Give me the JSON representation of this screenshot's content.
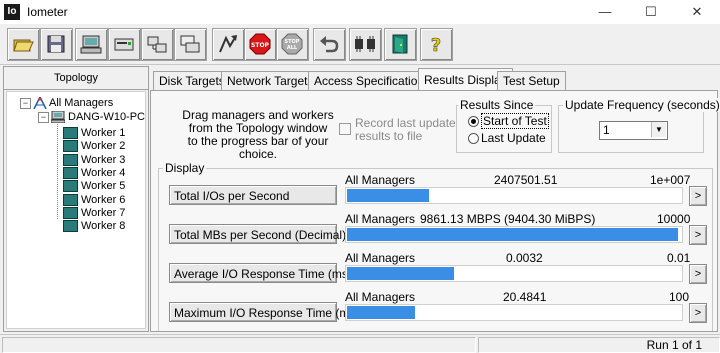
{
  "window": {
    "icon_text": "Io",
    "title": "Iometer"
  },
  "toolbar": {
    "icons": [
      "open-icon",
      "save-icon",
      "new-manager-icon",
      "new-disk-worker-icon",
      "new-network-worker-icon",
      "duplicate-worker-icon",
      "start-icon",
      "stop-icon",
      "stop-all-icon",
      "reset-workers-icon",
      "disconnect-icon",
      "exit-icon",
      "help-icon"
    ]
  },
  "topology": {
    "header": "Topology",
    "root": "All Managers",
    "manager": "DANG-W10-PC",
    "workers": [
      "Worker 1",
      "Worker 2",
      "Worker 3",
      "Worker 4",
      "Worker 5",
      "Worker 6",
      "Worker 7",
      "Worker 8"
    ]
  },
  "tabs": [
    "Disk Targets",
    "Network Targets",
    "Access Specifications",
    "Results Display",
    "Test Setup"
  ],
  "active_tab": "Results Display",
  "drag_instructions": [
    "Drag managers and workers",
    "from the Topology window",
    "to the progress bar of your choice."
  ],
  "record_last_update": {
    "label_line1": "Record last update",
    "label_line2": "results to file",
    "checked": false
  },
  "results_since": {
    "label": "Results Since",
    "options": [
      "Start of Test",
      "Last Update"
    ],
    "selected": "Start of Test"
  },
  "update_frequency": {
    "label": "Update Frequency (seconds)",
    "value": "1"
  },
  "display": {
    "label": "Display",
    "metrics": [
      {
        "button": "Total I/Os per Second",
        "scope": "All Managers",
        "value": "2407501.51",
        "max": "1e+007",
        "fill": 0.245
      },
      {
        "button": "Total MBs per Second (Decimal)",
        "scope": "All Managers",
        "value": "9861.13 MBPS (9404.30 MiBPS)",
        "max": "10000",
        "fill": 0.99
      },
      {
        "button": "Average I/O Response Time (ms)",
        "scope": "All Managers",
        "value": "0.0032",
        "max": "0.01",
        "fill": 0.32
      },
      {
        "button": "Maximum I/O Response Time (ms)",
        "scope": "All Managers",
        "value": "20.4841",
        "max": "100",
        "fill": 0.205
      }
    ],
    "more_button": ">"
  },
  "status": {
    "run": "Run 1 of 1"
  },
  "colors": {
    "bar": "#3a8ee6",
    "worker_icon": "#2a7a7a"
  }
}
